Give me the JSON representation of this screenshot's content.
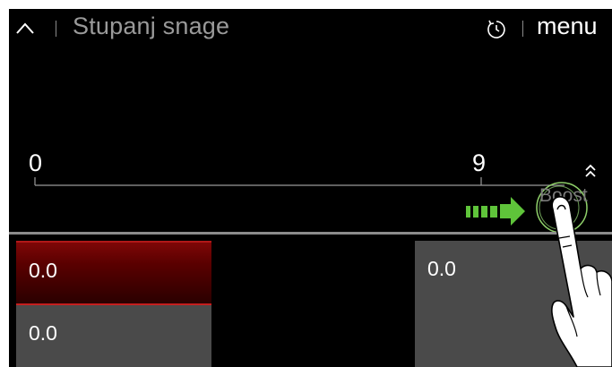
{
  "header": {
    "title": "Stupanj snage",
    "menu_label": "menu"
  },
  "slider": {
    "min_label": "0",
    "max_label": "9",
    "boost_label": "Boost"
  },
  "tiles": [
    {
      "value": "0.0",
      "state": "selected",
      "color": "#6a0000"
    },
    {
      "value": "0.0",
      "state": "normal",
      "color": "#4a4a4a"
    },
    {
      "value": "0.0",
      "state": "normal",
      "color": "#4a4a4a"
    }
  ],
  "colors": {
    "arrow": "#5fc43a",
    "boost_ring": "#8fd06a"
  },
  "icons": [
    "chevron-up-icon",
    "timer-icon",
    "double-chevron-up-icon",
    "boost-arrow-icon",
    "hand-pointer-icon"
  ]
}
